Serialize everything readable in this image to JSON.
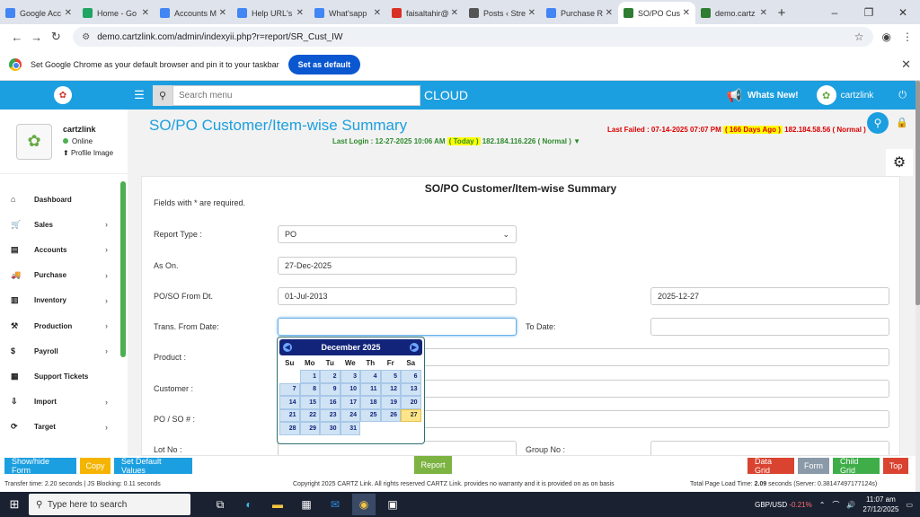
{
  "browser": {
    "tabs": [
      {
        "title": "Google Acc",
        "color": "#4285f4"
      },
      {
        "title": "Home - Go",
        "color": "#1fa463"
      },
      {
        "title": "Accounts M",
        "color": "#4285f4"
      },
      {
        "title": "Help URL's",
        "color": "#4285f4"
      },
      {
        "title": "What'sapp",
        "color": "#4285f4"
      },
      {
        "title": "faisaltahir@",
        "color": "#d93025"
      },
      {
        "title": "Posts ‹ Stre",
        "color": "#555555"
      },
      {
        "title": "Purchase Re",
        "color": "#4285f4"
      },
      {
        "title": "SO/PO Cust",
        "color": "#2e7d32"
      },
      {
        "title": "demo.cartz",
        "color": "#2e7d32"
      }
    ],
    "url": "demo.cartzlink.com/admin/indexyii.php?r=report/SR_Cust_IW",
    "infobar_text": "Set Google Chrome as your default browser and pin it to your taskbar",
    "infobar_button": "Set as default"
  },
  "topbar": {
    "search_placeholder": "Search menu",
    "cloud_label": "CLOUD",
    "whats_new": "Whats New!",
    "username": "cartzlink"
  },
  "sidebar": {
    "profile_name": "cartzlink",
    "status": "Online",
    "profile_image_label": "Profile Image",
    "items": [
      {
        "label": "Dashboard",
        "has_arrow": false
      },
      {
        "label": "Sales",
        "has_arrow": true
      },
      {
        "label": "Accounts",
        "has_arrow": true
      },
      {
        "label": "Purchase",
        "has_arrow": true
      },
      {
        "label": "Inventory",
        "has_arrow": true
      },
      {
        "label": "Production",
        "has_arrow": true
      },
      {
        "label": "Payroll",
        "has_arrow": true
      },
      {
        "label": "Support Tickets",
        "has_arrow": false
      },
      {
        "label": "Import",
        "has_arrow": true
      },
      {
        "label": "Target",
        "has_arrow": true
      }
    ]
  },
  "header": {
    "title": "SO/PO Customer/Item-wise Summary",
    "last_login_prefix": "Last Login : 12-27-2025 10:06 AM ",
    "last_login_highlight": "( Today )",
    "last_login_suffix": " 182.184.116.226 ( Normal ) ▼",
    "last_failed_prefix": "Last Failed : 07-14-2025 07:07 PM ",
    "last_failed_highlight": "( 166 Days Ago )",
    "last_failed_suffix": " 182.184.58.56 ( Normal ) ▼"
  },
  "form": {
    "title": "SO/PO Customer/Item-wise Summary",
    "required_note": "Fields with * are required.",
    "report_type_label": "Report Type :",
    "report_type_value": "PO",
    "as_on_label": "As On.",
    "as_on_value": "27-Dec-2025",
    "from_dt_label": "PO/SO From Dt.",
    "from_dt_value": "01-Jul-2013",
    "to_dt_value": "2025-12-27",
    "trans_from_label": "Trans. From Date:",
    "to_date_label": "To Date:",
    "product_label": "Product :",
    "customer_label": "Customer :",
    "po_so_label": "PO / SO # :",
    "lot_no_label": "Lot No :",
    "group_no_label": "Group No :"
  },
  "datepicker": {
    "month_year": "December 2025",
    "weekdays": [
      "Su",
      "Mo",
      "Tu",
      "We",
      "Th",
      "Fr",
      "Sa"
    ],
    "leading_blanks": 1,
    "days": [
      "1",
      "2",
      "3",
      "4",
      "5",
      "6",
      "7",
      "8",
      "9",
      "10",
      "11",
      "12",
      "13",
      "14",
      "15",
      "16",
      "17",
      "18",
      "19",
      "20",
      "21",
      "22",
      "23",
      "24",
      "25",
      "26",
      "27",
      "28",
      "29",
      "30",
      "31"
    ],
    "today": "27"
  },
  "buttons": {
    "show_hide_form": "Show/hide Form",
    "copy": "Copy",
    "set_default_values": "Set Default Values",
    "report": "Report",
    "data_grid": "Data Grid",
    "form": "Form",
    "child_grid": "Child Grid",
    "top": "Top"
  },
  "status_bar": {
    "left": "Transfer time: 2.20 seconds  |  JS Blocking: 0.11 seconds",
    "center": "Copyright 2025 CARTZ Link. All rights reserved CARTZ Link. provides no warranty and it is provided on as on basis",
    "right_prefix": "Total Page Load Time: ",
    "right_bold": "2.09",
    "right_suffix": " seconds (Server: 0.38147497177124s)"
  },
  "taskbar": {
    "search_placeholder": "Type here to search",
    "currency": "GBP/USD",
    "currency_change": "-0.21%",
    "time": "11:07 am",
    "date": "27/12/2025"
  }
}
